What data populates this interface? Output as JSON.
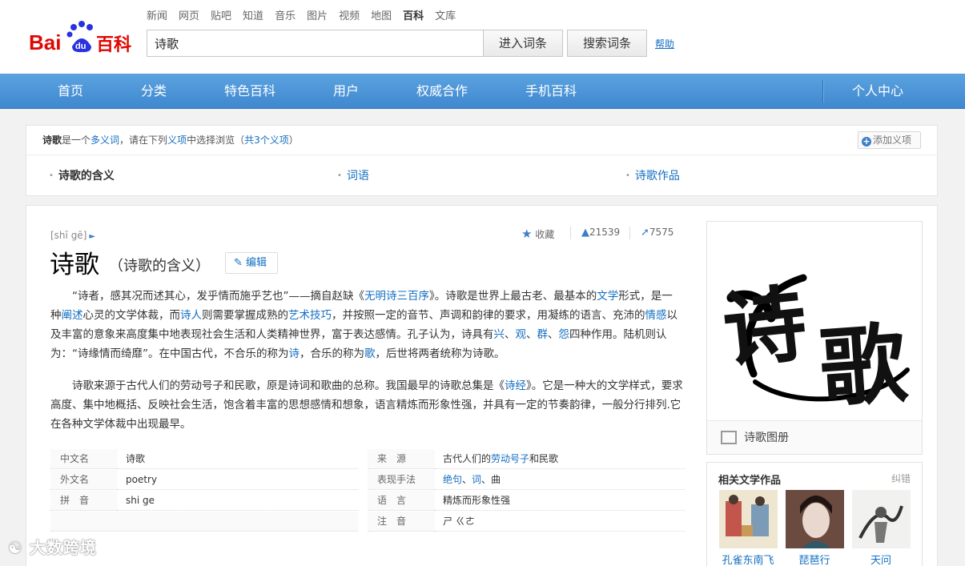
{
  "header": {
    "logo_text": "Bai du 百科",
    "topnav": [
      "新闻",
      "网页",
      "贴吧",
      "知道",
      "音乐",
      "图片",
      "视频",
      "地图",
      "百科",
      "文库"
    ],
    "topnav_active": "百科",
    "search_value": "诗歌",
    "enter_button": "进入词条",
    "search_button": "搜索词条",
    "help": "帮助"
  },
  "mainnav": {
    "items": [
      "首页",
      "分类",
      "特色百科",
      "用户",
      "权威合作",
      "手机百科"
    ],
    "personal": "个人中心"
  },
  "polysemy": {
    "term": "诗歌",
    "text_1": "是一个",
    "link_1": "多义词",
    "text_2": "，请在下列",
    "link_2": "义项",
    "text_3": "中选择浏览（",
    "link_3": "共3个义项",
    "text_4": "）",
    "add_button": "添加义项",
    "options": [
      "诗歌的含义",
      "词语",
      "诗歌作品"
    ]
  },
  "entry": {
    "pinyin": "[shī gē]",
    "title": "诗歌",
    "subtitle": "（诗歌的含义）",
    "edit": "编辑",
    "collect": "收藏",
    "likes": "21539",
    "shares": "7575"
  },
  "paragraph1": {
    "s1": "“诗者，感其况而述其心，发乎情而施乎艺也”——摘自赵缺《",
    "l1": "无明诗三百序",
    "s2": "》。诗歌是世界上最古老、最基本的",
    "l2": "文学",
    "s3": "形式，是一种",
    "l3": "阐述",
    "s4": "心灵的文学体裁，而",
    "l4": "诗人",
    "s5": "则需要掌握成熟的",
    "l5": "艺术技巧",
    "s6": "，并按照一定的音节、声调和韵律的要求，用凝练的语言、充沛的",
    "l6": "情感",
    "s7": "以及丰富的意象来高度集中地表现社会生活和人类精神世界，富于表达感情。孔子认为，诗具有",
    "l7": "兴",
    "s8": "、",
    "l8": "观",
    "s9": "、",
    "l9": "群",
    "s10": "、",
    "l10": "怨",
    "s11": "四种作用。陆机则认为：“诗缘情而绮靡”。在中国古代，不合乐的称为",
    "l11": "诗",
    "s12": "，合乐的称为",
    "l12": "歌",
    "s13": "，后世将两者统称为诗歌。"
  },
  "paragraph2": {
    "s1": "诗歌来源于古代人们的劳动号子和民歌，原是诗词和歌曲的总称。我国最早的诗歌总集是《",
    "l1": "诗经",
    "s2": "》。它是一种大的文学样式，要求高度、集中地概括、反映社会生活，饱含着丰富的思想感情和想象，语言精炼而形象性强，并具有一定的节奏韵律，一般分行排列.它在各种文学体裁中出现最早。"
  },
  "infobox": {
    "left": [
      {
        "label": "中文名",
        "value": "诗歌"
      },
      {
        "label": "外文名",
        "value": "poetry"
      },
      {
        "label": "拼　音",
        "value": "shi ge"
      }
    ],
    "right": [
      {
        "label": "来　源",
        "value_pre": "古代人们的",
        "value_link": "劳动号子",
        "value_post": "和民歌"
      },
      {
        "label": "表现手法",
        "link1": "绝句",
        "sep1": "、",
        "link2": "词",
        "sep2": "、",
        "plain": "曲"
      },
      {
        "label": "语　言",
        "value": "精炼而形象性强"
      },
      {
        "label": "注　音",
        "value": "ㄕ ㄍㄜ"
      }
    ]
  },
  "sidebar": {
    "image_text_1": "诗",
    "image_text_2": "歌",
    "album": "诗歌图册",
    "related_title": "相关文学作品",
    "related_error": "纠错",
    "related_items": [
      "孔雀东南飞",
      "琵琶行",
      "天问"
    ]
  },
  "watermark": "大数跨境",
  "colors": {
    "nav_blue": "#4a95d8",
    "link_blue": "#136ec2",
    "logo_red": "#e10601",
    "logo_blue": "#2932e1"
  }
}
